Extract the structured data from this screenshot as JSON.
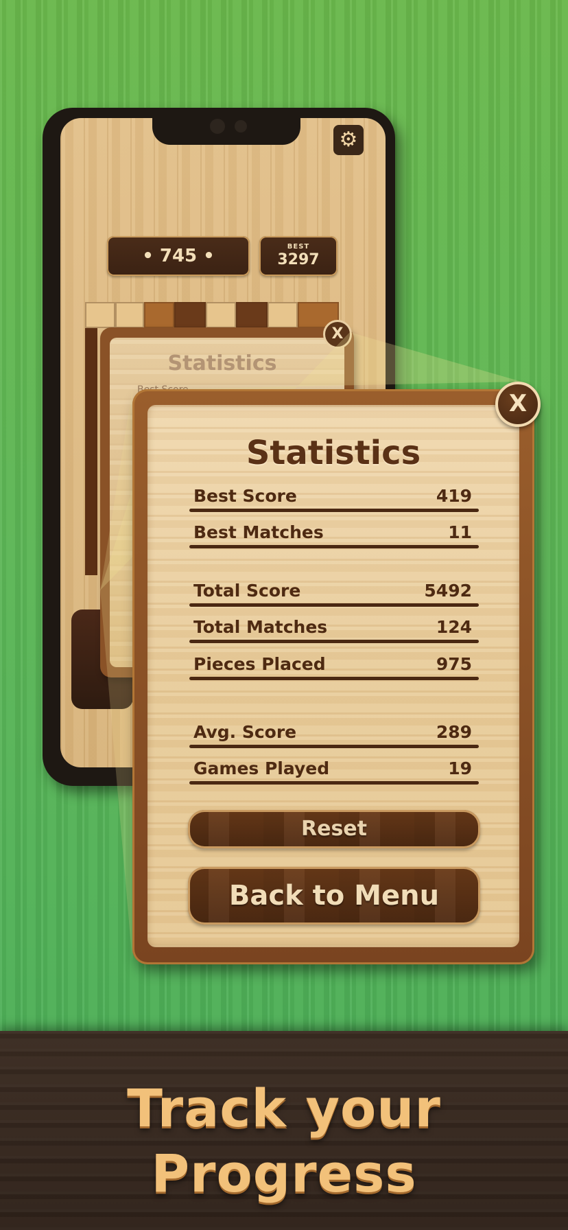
{
  "phone": {
    "score": "• 745 •",
    "best_label": "BEST",
    "best_value": "3297",
    "settings_icon": "gear-icon"
  },
  "back_panel": {
    "title": "Statistics",
    "stub_text": "Best Score",
    "close_label": "X"
  },
  "stats_panel": {
    "title": "Statistics",
    "close_label": "X",
    "rows": [
      {
        "label": "Best Score",
        "value": "419"
      },
      {
        "label": "Best Matches",
        "value": "11"
      },
      {
        "label": "Total Score",
        "value": "5492"
      },
      {
        "label": "Total Matches",
        "value": "124"
      },
      {
        "label": "Pieces Placed",
        "value": "975"
      },
      {
        "label": "Avg. Score",
        "value": "289"
      },
      {
        "label": "Games Played",
        "value": "19"
      }
    ],
    "reset_label": "Reset",
    "back_label": "Back to Menu"
  },
  "banner": {
    "line1": "Track your",
    "line2": "Progress"
  },
  "colors": {
    "background_green": "#5cb656",
    "wood_light": "#f0d8ae",
    "wood_dark": "#4e2a12",
    "banner_text": "#f2c17a"
  }
}
